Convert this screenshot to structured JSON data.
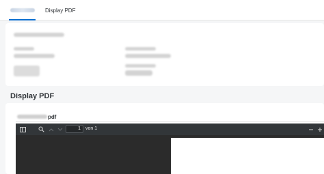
{
  "tabs": [
    {
      "label": ""
    },
    {
      "label": "Display PDF"
    }
  ],
  "section": {
    "title": "Display PDF"
  },
  "attachment": {
    "file_suffix": "pdf"
  },
  "viewer": {
    "page_number": "1",
    "page_total": "von 1",
    "icons": {
      "sidebar": "sidebar-toggle-icon",
      "search": "search-icon",
      "prev": "chevron-up-icon",
      "next": "chevron-down-icon",
      "zoom_out": "minus-icon",
      "zoom_in": "plus-icon"
    }
  },
  "colors": {
    "accent": "#0a6ed1",
    "viewer_toolbar": "#323639",
    "viewer_body": "#2b2b2b",
    "page_background": "#f5f6f7"
  }
}
